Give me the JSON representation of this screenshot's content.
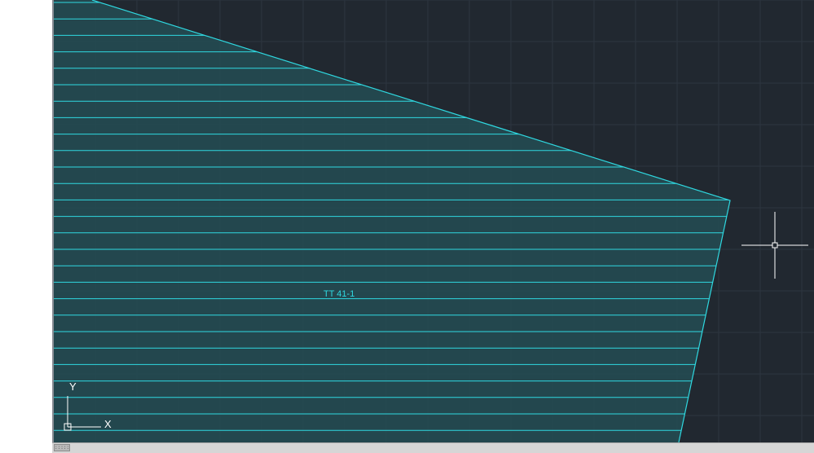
{
  "drawing": {
    "region_label": "TT 41-1",
    "hatch_color": "#2fd8e0",
    "fill_color": "#234a52",
    "background_color": "#212830",
    "grid_color": "#2d3640",
    "crosshair_color": "#ffffff"
  },
  "ucs_icon": {
    "x_label": "X",
    "y_label": "Y"
  },
  "status": {
    "tab_handle": "::::::"
  }
}
